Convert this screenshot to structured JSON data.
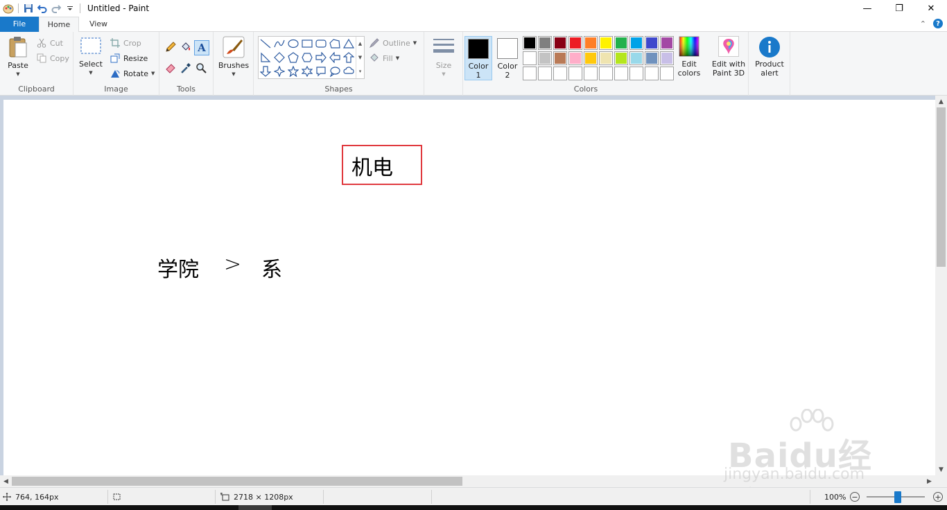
{
  "window": {
    "title": "Untitled - Paint",
    "minimize_glyph": "—",
    "restore_glyph": "❐",
    "close_glyph": "✕"
  },
  "tabs": {
    "file": "File",
    "home": "Home",
    "view": "View",
    "help_glyph": "?",
    "collapse_glyph": "⌃"
  },
  "ribbon": {
    "clipboard": {
      "label": "Clipboard",
      "paste": "Paste",
      "cut": "Cut",
      "copy": "Copy"
    },
    "image": {
      "label": "Image",
      "select": "Select",
      "crop": "Crop",
      "resize": "Resize",
      "rotate": "Rotate"
    },
    "tools": {
      "label": "Tools"
    },
    "brushes": {
      "label": "Brushes"
    },
    "shapes": {
      "label": "Shapes",
      "outline": "Outline",
      "fill": "Fill"
    },
    "size": {
      "label": "Size"
    },
    "colors": {
      "label": "Colors",
      "color1_line1": "Color",
      "color1_line2": "1",
      "color2_line1": "Color",
      "color2_line2": "2",
      "edit_colors_line1": "Edit",
      "edit_colors_line2": "colors",
      "color1_value": "#000000",
      "color2_value": "#ffffff",
      "palette_row1": [
        "#000000",
        "#7f7f7f",
        "#880015",
        "#ed1c24",
        "#ff7f27",
        "#fff200",
        "#22b14c",
        "#00a2e8",
        "#3f48cc",
        "#a349a4"
      ],
      "palette_row2": [
        "#ffffff",
        "#c3c3c3",
        "#b97a57",
        "#ffaec9",
        "#ffc90e",
        "#efe4b0",
        "#b5e61d",
        "#99d9ea",
        "#7092be",
        "#c8bfe7"
      ]
    },
    "paint3d": {
      "line1": "Edit with",
      "line2": "Paint 3D"
    },
    "product_alert": {
      "line1": "Product",
      "line2": "alert"
    }
  },
  "canvas": {
    "text_box": "机电",
    "line_left": "学院",
    "line_arrow": ">",
    "line_right": "系"
  },
  "status": {
    "cursor_pos": "764, 164px",
    "canvas_size": "2718 × 1208px",
    "zoom": "100%",
    "zoom_fraction": 0.5
  },
  "watermark": {
    "logo": "Baidu经验",
    "url": "jingyan.baidu.com"
  }
}
